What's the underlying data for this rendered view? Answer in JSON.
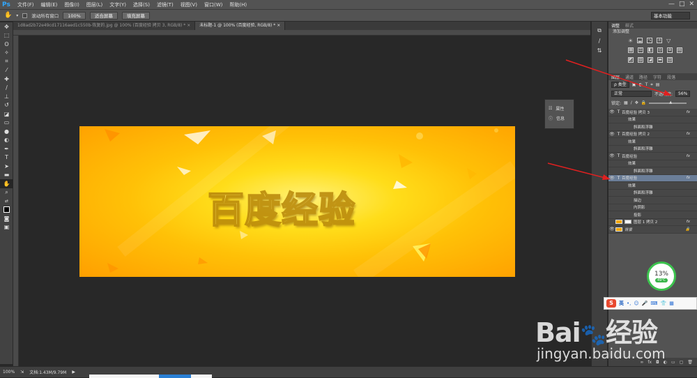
{
  "app": {
    "logo": "Ps"
  },
  "menubar": {
    "items": [
      "文件(F)",
      "编辑(E)",
      "图像(I)",
      "图层(L)",
      "文字(Y)",
      "选择(S)",
      "滤镜(T)",
      "视图(V)",
      "窗口(W)",
      "帮助(H)"
    ]
  },
  "window_controls": {
    "minimize": "—",
    "maximize": "□",
    "close": "✕"
  },
  "options": {
    "scroll_all": "滚动所有窗口",
    "zoom": "100%",
    "fit_screen": "适合屏幕",
    "fill_screen": "填充屏幕",
    "workspace": "基本功能"
  },
  "tabs": [
    {
      "label": "1d8ad2b72e49cd17116aed1c550b-恢复的.jpg @ 100% (百度经验 拷贝 3, RGB/8) *",
      "close": "×"
    },
    {
      "label": "未标题-1 @ 100% (百度经验, RGB/8) *",
      "close": "×"
    }
  ],
  "artwork": {
    "text": "百度经验"
  },
  "props_panel": {
    "properties": "属性",
    "info": "信息"
  },
  "status": {
    "zoom": "100%",
    "doc": "文档:1.43M/9.79M"
  },
  "right_panel": {
    "tabs": [
      "调整",
      "样式"
    ],
    "adjust_title": "添加调整",
    "layer_tabs": [
      "图层",
      "通道",
      "路径",
      "字符",
      "段落"
    ],
    "kind": "ρ 类型",
    "blend": "正常",
    "opacity_label": "不透明度:",
    "opacity_value": "56%",
    "lock_label": "锁定:",
    "layers": [
      {
        "type": "T",
        "name": "百度经验 拷贝 3",
        "fx": "fx",
        "subs": [
          "效果",
          "斜面和浮雕"
        ]
      },
      {
        "type": "T",
        "name": "百度经验 拷贝 2",
        "fx": "fx",
        "subs": [
          "效果",
          "斜面和浮雕"
        ]
      },
      {
        "type": "T",
        "name": "百度经验",
        "fx": "fx",
        "subs": [
          "效果",
          "斜面和浮雕"
        ]
      },
      {
        "type": "T",
        "name": "百度经验",
        "fx": "fx",
        "selected": true,
        "subs": [
          "效果",
          "斜面和浮雕",
          "描边",
          "内阴影",
          "投影"
        ]
      },
      {
        "type": "img",
        "name": "图层 1 拷贝 2",
        "fx": "fx"
      },
      {
        "type": "bg",
        "name": "背景",
        "lock": "🔒"
      }
    ]
  },
  "cpu_widget": {
    "percent": "13%",
    "temp": "49℃"
  },
  "ime": {
    "logo": "S",
    "lang": "英"
  },
  "watermark": {
    "logo": "Bai",
    "logo2": "经验",
    "url": "jingyan.baidu.com"
  },
  "colors": {
    "accent": "#31a8ff",
    "arrow": "#e02020",
    "selected_layer": "#6b7e98",
    "artwork_center": "#fff176",
    "artwork_edge": "#ff9f00"
  }
}
